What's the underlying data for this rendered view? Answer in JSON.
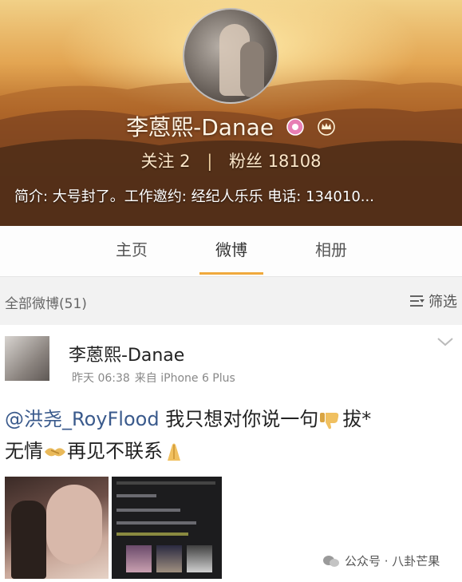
{
  "profile": {
    "name": "李蒽熙-Danae",
    "following_label": "关注",
    "following_count": "2",
    "separator": "|",
    "followers_label": "粉丝",
    "followers_count": "18108",
    "bio": "简介: 大号封了。工作邀约: 经纪人乐乐 电话: 134010..."
  },
  "tabs": [
    {
      "label": "主页",
      "active": false
    },
    {
      "label": "微博",
      "active": true
    },
    {
      "label": "相册",
      "active": false
    }
  ],
  "filter": {
    "count_label": "全部微博(51)",
    "filter_label": "筛选"
  },
  "post": {
    "author": "李蒽熙-Danae",
    "time": "昨天 06:38",
    "source": "来自 iPhone 6 Plus",
    "mention": "@洪尧_RoyFlood",
    "text_1": " 我只想对你说一句",
    "text_2": "拔*",
    "text_3": "无情",
    "text_4": "再见不联系"
  },
  "watermark": "公众号 · 八卦芒果",
  "colors": {
    "accent_underline": "#f0a93c",
    "mention": "#3a5a8c"
  },
  "icons": {
    "vip_badge": "vip-badge-icon",
    "crown": "crown-icon",
    "filter": "filter-icon",
    "caret": "chevron-down-icon",
    "thumbs_down": "thumbs-down-emoji",
    "handshake": "handshake-emoji",
    "pray": "pray-emoji",
    "wechat": "wechat-icon"
  }
}
